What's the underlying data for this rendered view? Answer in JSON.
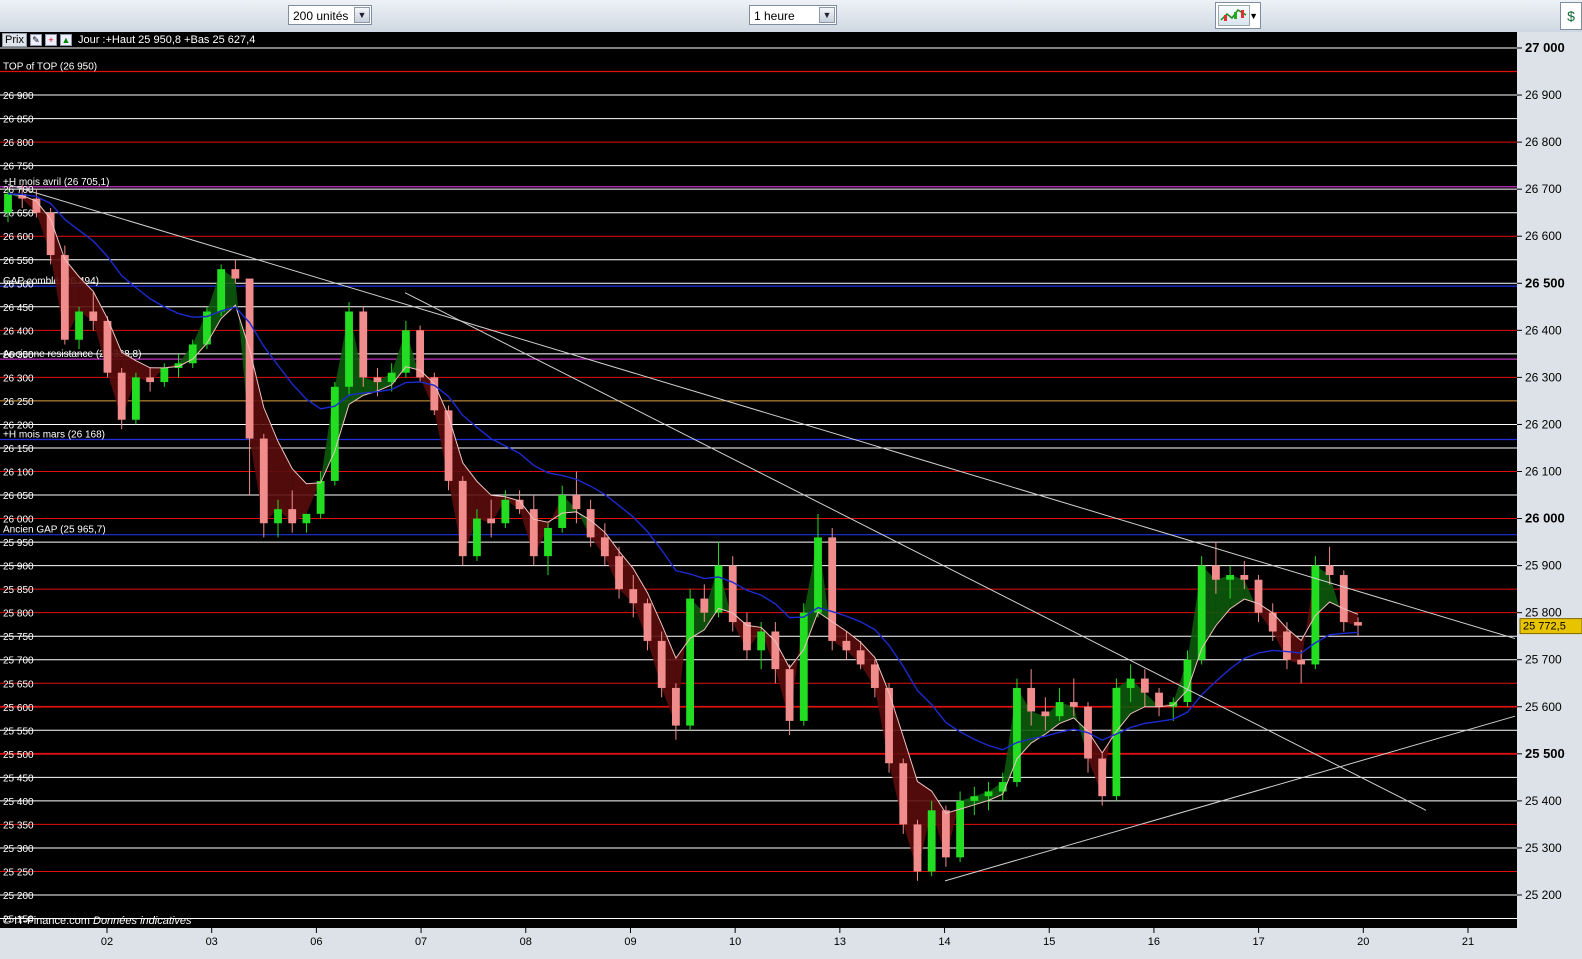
{
  "toolbar": {
    "units_select": "200 unités",
    "interval_select": "1 heure",
    "chart_type_icon": "candlestick-chart-icon"
  },
  "legend": {
    "prix_label": "Prix",
    "day_info": "Jour :+Haut 25 950,8 +Bas 25 627,4"
  },
  "footer": {
    "copyright": "© IT-Finance.com",
    "note": "Données indicatives"
  },
  "colors": {
    "background": "#000000",
    "up_candle": "#22dd22",
    "down_candle": "#f08c8c",
    "ma_fast": "#f0c0c0",
    "ma_slow": "#1c2ad0",
    "red_level": "#e01010",
    "white_level": "#ffffff",
    "current_price_bg": "#e8c400"
  },
  "chart_data": {
    "type": "candlestick",
    "ylim": [
      25130,
      27030
    ],
    "y_ticks_right": [
      27000,
      26900,
      26800,
      26700,
      26600,
      26500,
      26400,
      26300,
      26200,
      26100,
      26000,
      25900,
      25800,
      25700,
      25600,
      25500,
      25400,
      25300,
      25200
    ],
    "y_ticks_right_bold": [
      27000,
      26500,
      26000,
      25500
    ],
    "y_labels_left": [
      26900,
      26850,
      26800,
      26750,
      26700,
      26650,
      26600,
      26550,
      26500,
      26450,
      26400,
      26350,
      26300,
      26250,
      26200,
      26150,
      26100,
      26050,
      26000,
      25950,
      25900,
      25850,
      25800,
      25750,
      25700,
      25650,
      25600,
      25550,
      25500,
      25450,
      25400,
      25350,
      25300,
      25250,
      25200,
      25150
    ],
    "x_labels": [
      "02",
      "03",
      "06",
      "07",
      "08",
      "09",
      "10",
      "13",
      "14",
      "15",
      "16",
      "17",
      "20",
      "21"
    ],
    "current_price": 25772.5,
    "current_price_label": "25 772,5",
    "named_levels": [
      {
        "label": "TOP of TOP (26 950)",
        "value": 26950,
        "color": "red"
      },
      {
        "label": "+H mois avril (26 705,1)",
        "value": 26705.1,
        "color": "purple"
      },
      {
        "label": "GAP comblé (26 494)",
        "value": 26494,
        "color": "blue"
      },
      {
        "label": "Ancienne resistance (26 338,8)",
        "value": 26338.8,
        "color": "purple"
      },
      {
        "label": "+H mois mars (26 168)",
        "value": 26168,
        "color": "blue"
      },
      {
        "label": "Ancien GAP (25 965,7)",
        "value": 25965.7,
        "color": "blue"
      }
    ],
    "red_levels": [
      26950,
      26800,
      26600,
      26400,
      26300,
      26100,
      26000,
      25850,
      25800,
      25650,
      25600,
      25500,
      25350,
      25250
    ],
    "white_levels": [
      27000,
      26900,
      26850,
      26750,
      26700,
      26650,
      26550,
      26500,
      26450,
      26350,
      26200,
      26150,
      26050,
      25950,
      25900,
      25750,
      25700,
      25550,
      25450,
      25400,
      25300,
      25200,
      25150
    ],
    "orange_levels": [
      26250
    ],
    "trendlines": [
      {
        "from": [
          "01",
          26710
        ],
        "to": [
          "20",
          25750
        ]
      },
      {
        "from": [
          "06",
          26480
        ],
        "to": [
          "20",
          25380
        ]
      },
      {
        "from": [
          "14",
          25230
        ],
        "to": [
          "21",
          25580
        ]
      }
    ],
    "series": [
      {
        "type": "ohlc",
        "points": [
          [
            26650,
            26700,
            26630,
            26690
          ],
          [
            26690,
            26710,
            26660,
            26680
          ],
          [
            26680,
            26700,
            26640,
            26650
          ],
          [
            26650,
            26660,
            26540,
            26560
          ],
          [
            26560,
            26580,
            26370,
            26380
          ],
          [
            26380,
            26450,
            26360,
            26440
          ],
          [
            26440,
            26480,
            26400,
            26420
          ],
          [
            26420,
            26430,
            26300,
            26310
          ],
          [
            26310,
            26320,
            26190,
            26210
          ],
          [
            26210,
            26310,
            26200,
            26300
          ],
          [
            26300,
            26320,
            26270,
            26290
          ],
          [
            26290,
            26330,
            26280,
            26320
          ],
          [
            26320,
            26350,
            26300,
            26330
          ],
          [
            26330,
            26380,
            26320,
            26370
          ],
          [
            26370,
            26450,
            26360,
            26440
          ],
          [
            26440,
            26540,
            26430,
            26530
          ],
          [
            26530,
            26550,
            26500,
            26510
          ],
          [
            26510,
            26300,
            26050,
            26170
          ],
          [
            26170,
            26180,
            25960,
            25990
          ],
          [
            25990,
            26040,
            25960,
            26020
          ],
          [
            26020,
            26060,
            25970,
            25990
          ],
          [
            25990,
            26010,
            25970,
            26010
          ],
          [
            26010,
            26100,
            26000,
            26080
          ],
          [
            26080,
            26290,
            26070,
            26280
          ],
          [
            26280,
            26460,
            26260,
            26440
          ],
          [
            26440,
            26450,
            26280,
            26300
          ],
          [
            26300,
            26320,
            26260,
            26290
          ],
          [
            26290,
            26330,
            26270,
            26310
          ],
          [
            26310,
            26420,
            26300,
            26400
          ],
          [
            26400,
            26410,
            26290,
            26300
          ],
          [
            26300,
            26310,
            26220,
            26230
          ],
          [
            26230,
            26240,
            26060,
            26080
          ],
          [
            26080,
            26090,
            25900,
            25920
          ],
          [
            25920,
            26020,
            25910,
            26000
          ],
          [
            26000,
            26040,
            25960,
            25990
          ],
          [
            25990,
            26060,
            25980,
            26040
          ],
          [
            26040,
            26060,
            26010,
            26020
          ],
          [
            26020,
            26050,
            25900,
            25920
          ],
          [
            25920,
            25990,
            25880,
            25980
          ],
          [
            25980,
            26070,
            25970,
            26050
          ],
          [
            26050,
            26100,
            25990,
            26020
          ],
          [
            26020,
            26040,
            25940,
            25960
          ],
          [
            25960,
            25990,
            25900,
            25920
          ],
          [
            25920,
            25940,
            25830,
            25850
          ],
          [
            25850,
            25880,
            25790,
            25820
          ],
          [
            25820,
            25830,
            25720,
            25740
          ],
          [
            25740,
            25760,
            25620,
            25640
          ],
          [
            25640,
            25650,
            25530,
            25560
          ],
          [
            25560,
            25850,
            25550,
            25830
          ],
          [
            25830,
            25860,
            25780,
            25800
          ],
          [
            25800,
            25950,
            25790,
            25900
          ],
          [
            25900,
            25920,
            25760,
            25780
          ],
          [
            25780,
            25800,
            25700,
            25720
          ],
          [
            25720,
            25780,
            25680,
            25760
          ],
          [
            25760,
            25780,
            25650,
            25680
          ],
          [
            25680,
            25690,
            25540,
            25570
          ],
          [
            25570,
            25820,
            25560,
            25800
          ],
          [
            25800,
            26010,
            25790,
            25960
          ],
          [
            25960,
            25980,
            25720,
            25740
          ],
          [
            25740,
            25760,
            25700,
            25720
          ],
          [
            25720,
            25740,
            25680,
            25690
          ],
          [
            25690,
            25700,
            25620,
            25640
          ],
          [
            25640,
            25650,
            25460,
            25480
          ],
          [
            25480,
            25490,
            25330,
            25350
          ],
          [
            25350,
            25360,
            25230,
            25250
          ],
          [
            25250,
            25400,
            25240,
            25380
          ],
          [
            25380,
            25390,
            25260,
            25280
          ],
          [
            25280,
            25420,
            25270,
            25400
          ],
          [
            25400,
            25430,
            25370,
            25410
          ],
          [
            25410,
            25440,
            25380,
            25420
          ],
          [
            25420,
            25460,
            25400,
            25440
          ],
          [
            25440,
            25660,
            25430,
            25640
          ],
          [
            25640,
            25680,
            25560,
            25590
          ],
          [
            25590,
            25620,
            25550,
            25580
          ],
          [
            25580,
            25640,
            25570,
            25610
          ],
          [
            25610,
            25660,
            25580,
            25600
          ],
          [
            25600,
            25610,
            25460,
            25490
          ],
          [
            25490,
            25500,
            25390,
            25410
          ],
          [
            25410,
            25660,
            25400,
            25640
          ],
          [
            25640,
            25690,
            25610,
            25660
          ],
          [
            25660,
            25680,
            25600,
            25630
          ],
          [
            25630,
            25640,
            25580,
            25600
          ],
          [
            25600,
            25620,
            25570,
            25610
          ],
          [
            25610,
            25720,
            25600,
            25700
          ],
          [
            25700,
            25920,
            25690,
            25900
          ],
          [
            25900,
            25950,
            25840,
            25870
          ],
          [
            25870,
            25900,
            25830,
            25880
          ],
          [
            25880,
            25910,
            25850,
            25870
          ],
          [
            25870,
            25880,
            25780,
            25800
          ],
          [
            25800,
            25820,
            25740,
            25760
          ],
          [
            25760,
            25780,
            25680,
            25700
          ],
          [
            25700,
            25720,
            25650,
            25690
          ],
          [
            25690,
            25920,
            25680,
            25900
          ],
          [
            25900,
            25940,
            25860,
            25880
          ],
          [
            25880,
            25890,
            25760,
            25780
          ],
          [
            25780,
            25790,
            25750,
            25772.5
          ]
        ]
      },
      {
        "name": "",
        "type": "ma_fast",
        "values": []
      },
      {
        "name": "",
        "type": "ma_slow",
        "values": []
      }
    ]
  }
}
